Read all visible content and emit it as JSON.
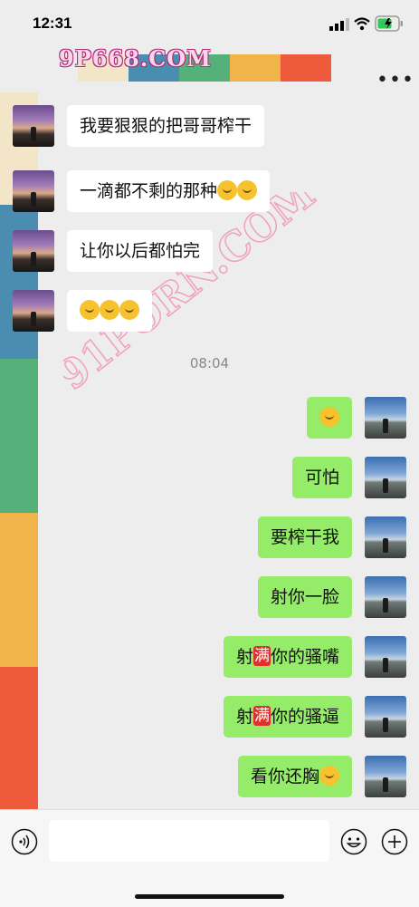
{
  "status": {
    "time": "12:31"
  },
  "nav": {
    "title": "9P668.COM",
    "more_label": "•••"
  },
  "colors": {
    "chat_bg": "#ededed",
    "outgoing_bubble": "#95ec69",
    "incoming_bubble": "#ffffff",
    "strip": [
      "#f3e6c8",
      "#4a8db0",
      "#55b07a",
      "#f0b44a",
      "#ee5a3c"
    ],
    "band": [
      "#f3e6c8",
      "#4a8db0",
      "#55b07a",
      "#f0b44a",
      "#ee5a3c"
    ]
  },
  "watermark": "91PORN.COM",
  "messages": [
    {
      "dir": "in",
      "text": "我要狠狠的把哥哥榨干"
    },
    {
      "dir": "in",
      "text": "一滴都不剩的那种",
      "emoji": [
        "thinking-face-emoji",
        "thinking-face-emoji"
      ]
    },
    {
      "dir": "in",
      "text": "让你以后都怕完"
    },
    {
      "dir": "in",
      "text": "",
      "emoji": [
        "smiling-face-emoji",
        "smiling-face-emoji",
        "smiling-face-emoji"
      ]
    },
    {
      "dir": "time",
      "text": "08:04"
    },
    {
      "dir": "out",
      "text": "",
      "emoji": [
        "rolling-laughing-emoji"
      ]
    },
    {
      "dir": "out",
      "text": "可怕"
    },
    {
      "dir": "out",
      "text": "要榨干我"
    },
    {
      "dir": "out",
      "text": "射你一脸"
    },
    {
      "dir": "out",
      "pre": "射",
      "badge": "满",
      "text": "你的骚嘴"
    },
    {
      "dir": "out",
      "pre": "射",
      "badge": "满",
      "text": "你的骚逼"
    },
    {
      "dir": "out",
      "text": "看你还胸",
      "emoji": [
        "thinking-face-emoji"
      ]
    }
  ],
  "input": {
    "placeholder": ""
  },
  "icons": [
    "signal-icon",
    "wifi-icon",
    "battery-icon",
    "more-icon",
    "voice-icon",
    "emoji-icon",
    "add-icon"
  ]
}
